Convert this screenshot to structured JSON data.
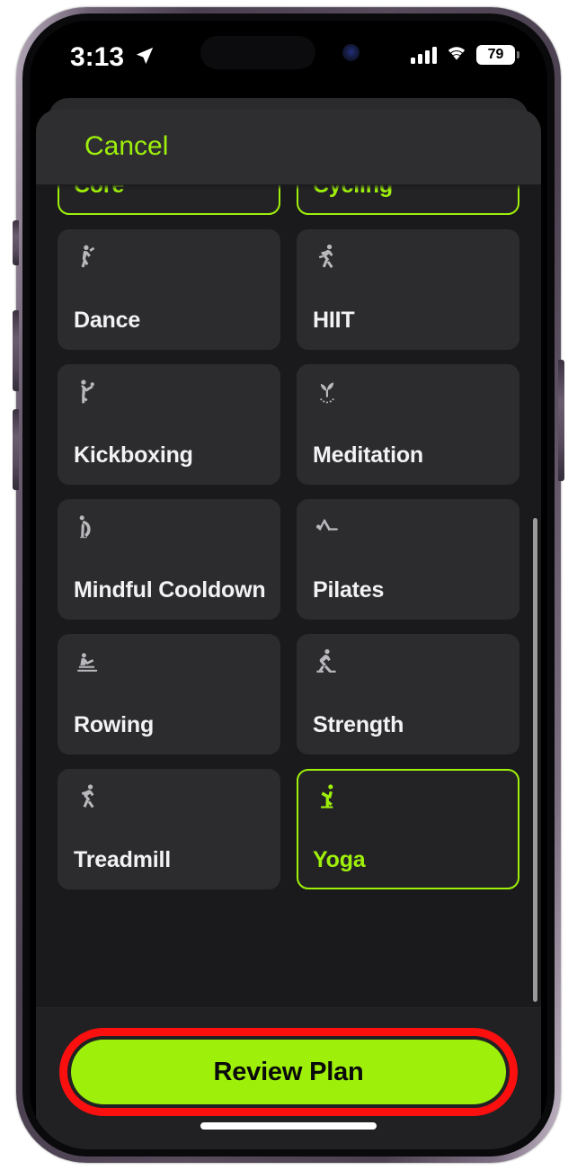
{
  "status_bar": {
    "time": "3:13",
    "location_icon": "location-arrow-icon",
    "cellular_icon": "cellular-bars-icon",
    "wifi_icon": "wifi-icon",
    "battery_percent": "79"
  },
  "sheet": {
    "cancel_label": "Cancel"
  },
  "colors": {
    "accent_green": "#9ef00a",
    "annotation_red": "#fb0f0f",
    "card_background": "#2c2c2e",
    "sheet_background": "#1a1a1c",
    "label_white": "#f2f2f4",
    "icon_gray": "#b8b8bd"
  },
  "workout_grid": {
    "items": [
      {
        "label": "Core",
        "icon": "core-icon",
        "selected": true
      },
      {
        "label": "Cycling",
        "icon": "cycling-icon",
        "selected": true
      },
      {
        "label": "Dance",
        "icon": "dance-icon",
        "selected": false
      },
      {
        "label": "HIIT",
        "icon": "hiit-icon",
        "selected": false
      },
      {
        "label": "Kickboxing",
        "icon": "kickboxing-icon",
        "selected": false
      },
      {
        "label": "Meditation",
        "icon": "meditation-icon",
        "selected": false
      },
      {
        "label": "Mindful Cooldown",
        "icon": "mindful-cooldown-icon",
        "selected": false
      },
      {
        "label": "Pilates",
        "icon": "pilates-icon",
        "selected": false
      },
      {
        "label": "Rowing",
        "icon": "rowing-icon",
        "selected": false
      },
      {
        "label": "Strength",
        "icon": "strength-icon",
        "selected": false
      },
      {
        "label": "Treadmill",
        "icon": "treadmill-icon",
        "selected": false
      },
      {
        "label": "Yoga",
        "icon": "yoga-icon",
        "selected": true
      }
    ]
  },
  "footer": {
    "review_label": "Review Plan"
  }
}
